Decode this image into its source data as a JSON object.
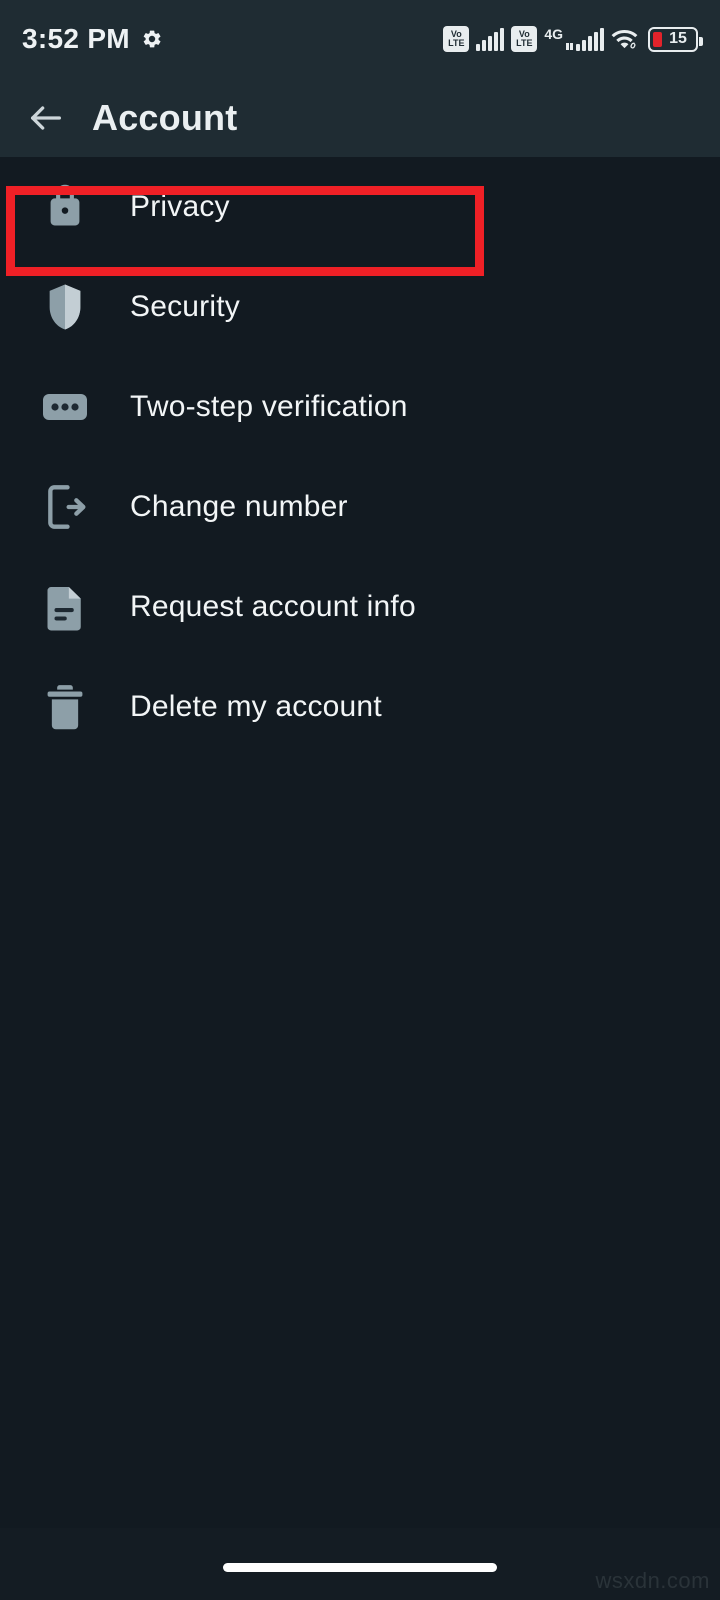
{
  "status_bar": {
    "time": "3:52 PM",
    "gear_icon": "gear-icon",
    "icons": [
      {
        "name": "volte-badge-sim1",
        "line1": "Vo",
        "line2": "LTE"
      },
      {
        "name": "signal-bars-sim1",
        "bars": 5
      },
      {
        "name": "volte-badge-sim2",
        "line1": "Vo",
        "line2": "LTE"
      },
      {
        "name": "network-type-label",
        "label": "4G"
      },
      {
        "name": "signal-bars-sim2",
        "bars": 5
      },
      {
        "name": "wifi-icon"
      },
      {
        "name": "battery-icon"
      }
    ],
    "network_type": "4G",
    "volte_line1": "Vo",
    "volte_line2": "LTE",
    "battery_level": "15",
    "battery_fill_color": "#e2232b"
  },
  "app_bar": {
    "back_icon": "arrow-left-icon",
    "title": "Account"
  },
  "list": {
    "items": [
      {
        "label": "Privacy",
        "icon": "lock-icon",
        "highlighted": true
      },
      {
        "label": "Security",
        "icon": "shield-icon",
        "highlighted": false
      },
      {
        "label": "Two-step verification",
        "icon": "dots-passcode-icon",
        "highlighted": false
      },
      {
        "label": "Change number",
        "icon": "phone-exit-icon",
        "highlighted": false
      },
      {
        "label": "Request account info",
        "icon": "document-icon",
        "highlighted": false
      },
      {
        "label": "Delete my account",
        "icon": "trash-icon",
        "highlighted": false
      }
    ]
  },
  "annotation": {
    "name": "privacy-highlight-box",
    "color": "#ef2026"
  },
  "nav_bar": {
    "home_indicator": "home-gesture-pill"
  },
  "watermark": {
    "text": "wsxdn.com"
  },
  "theme": {
    "app_bar_bg": "#1f2c33",
    "body_bg": "#121a21",
    "icon_color": "#8d9fa8",
    "text_color": "#f2f5f6"
  }
}
